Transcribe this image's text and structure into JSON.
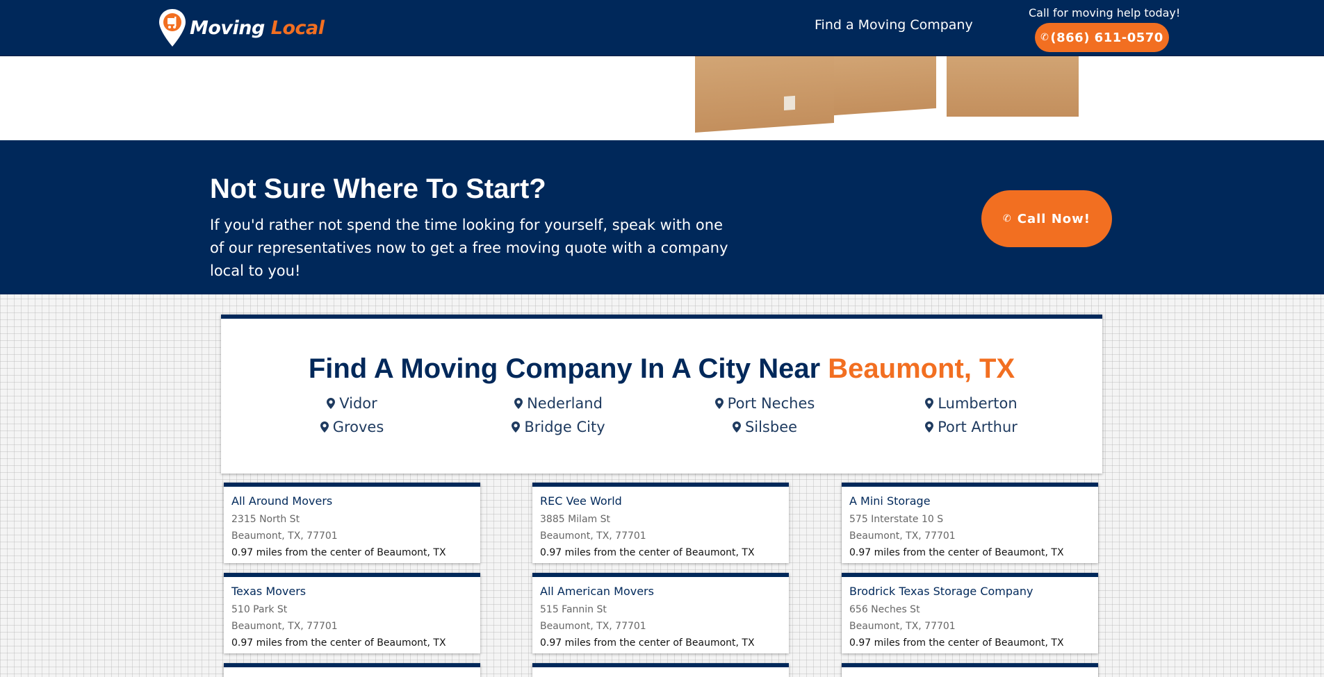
{
  "header": {
    "logo": {
      "word1": "Moving",
      "word2": "Local"
    },
    "nav_link": "Find a Moving Company",
    "call_help": "Call for moving help today!",
    "phone": "(866) 611-0570"
  },
  "cta": {
    "title": "Not Sure Where To Start?",
    "body": "If you'd rather not spend the time looking for yourself, speak with one of our representatives now to get a free moving quote with a company local to you!",
    "button": "Call Now!"
  },
  "cities": {
    "heading_prefix": "Find A Moving Company In A City Near ",
    "heading_highlight": "Beaumont, TX",
    "rows": [
      [
        "Vidor",
        "Nederland",
        "Port Neches",
        "Lumberton"
      ],
      [
        "Groves",
        "Bridge City",
        "Silsbee",
        "Port Arthur"
      ]
    ]
  },
  "listings": [
    {
      "name": "All Around Movers",
      "street": "2315 North St",
      "city": "Beaumont, TX, 77701",
      "distance": "0.97 miles from the center of Beaumont, TX"
    },
    {
      "name": "REC Vee World",
      "street": "3885 Milam St",
      "city": "Beaumont, TX, 77701",
      "distance": "0.97 miles from the center of Beaumont, TX"
    },
    {
      "name": "A Mini Storage",
      "street": "575 Interstate 10 S",
      "city": "Beaumont, TX, 77701",
      "distance": "0.97 miles from the center of Beaumont, TX"
    },
    {
      "name": "Texas Movers",
      "street": "510 Park St",
      "city": "Beaumont, TX, 77701",
      "distance": "0.97 miles from the center of Beaumont, TX"
    },
    {
      "name": "All American Movers",
      "street": "515 Fannin St",
      "city": "Beaumont, TX, 77701",
      "distance": "0.97 miles from the center of Beaumont, TX"
    },
    {
      "name": "Brodrick Texas Storage Company",
      "street": "656 Neches St",
      "city": "Beaumont, TX, 77701",
      "distance": "0.97 miles from the center of Beaumont, TX"
    }
  ],
  "colors": {
    "navy": "#00285a",
    "orange": "#f26f21",
    "white": "#ffffff"
  },
  "icons": {
    "phone": "phone-icon",
    "location": "map-pin-icon",
    "logo": "location-pin-logo-icon"
  }
}
